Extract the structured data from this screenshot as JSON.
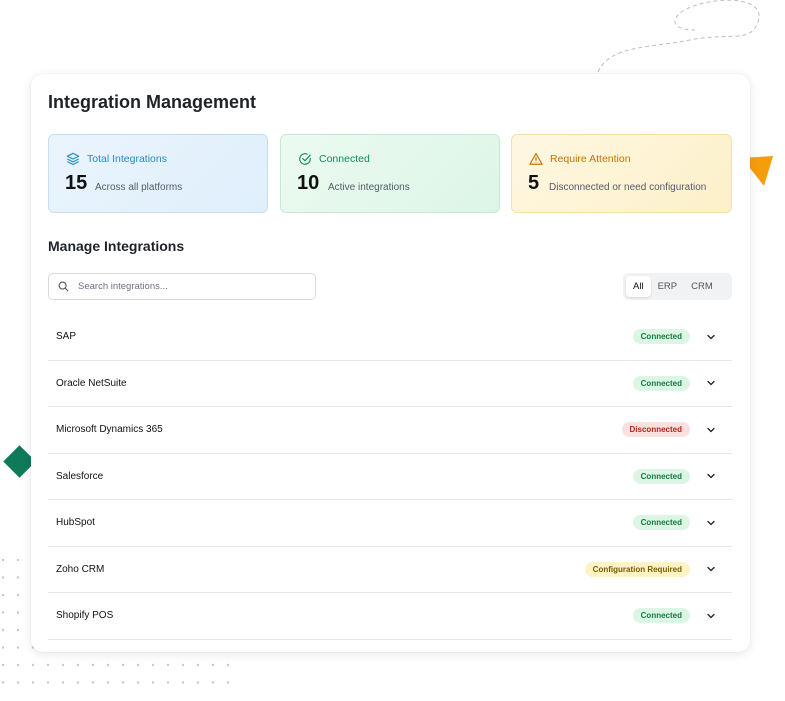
{
  "app": {
    "title": "Integration Management"
  },
  "stats": [
    {
      "label": "Total Integrations",
      "value": "15",
      "sub": "Across all platforms",
      "color": "#1f8ec7",
      "icon": "layers-icon"
    },
    {
      "label": "Connected",
      "value": "10",
      "sub": "Active integrations",
      "color": "#138a55",
      "icon": "check-circle-icon"
    },
    {
      "label": "Require Attention",
      "value": "5",
      "sub": "Disconnected or need configuration",
      "color": "#c8730a",
      "icon": "warning-icon"
    }
  ],
  "manage": {
    "heading": "Manage Integrations",
    "search_placeholder": "Search integrations...",
    "filters": [
      "All",
      "ERP",
      "CRM"
    ],
    "active_filter": "All"
  },
  "integrations": [
    {
      "name": "SAP",
      "status": "Connected"
    },
    {
      "name": "Oracle NetSuite",
      "status": "Connected"
    },
    {
      "name": "Microsoft Dynamics 365",
      "status": "Disconnected"
    },
    {
      "name": "Salesforce",
      "status": "Connected"
    },
    {
      "name": "HubSpot",
      "status": "Connected"
    },
    {
      "name": "Zoho CRM",
      "status": "Configuration Required"
    },
    {
      "name": "Shopify POS",
      "status": "Connected"
    }
  ],
  "colors": {
    "accent_green": "#0e7a5a",
    "accent_orange": "#f59e0b"
  }
}
